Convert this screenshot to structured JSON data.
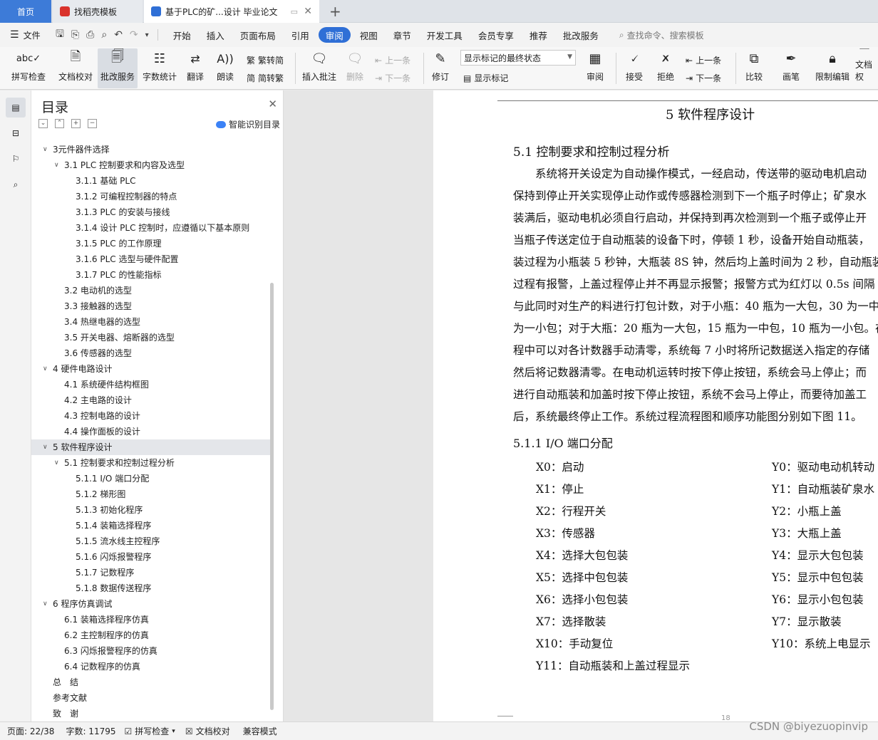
{
  "tabs": [
    {
      "label": "首页"
    },
    {
      "label": "找稻壳模板"
    },
    {
      "label": "基于PLC的矿...设计 毕业论文"
    }
  ],
  "menu": {
    "file": "文件",
    "items": [
      "开始",
      "插入",
      "页面布局",
      "引用",
      "审阅",
      "视图",
      "章节",
      "开发工具",
      "会员专享",
      "推荐",
      "批改服务"
    ],
    "active": "审阅",
    "search_placeholder": "查找命令、搜索模板"
  },
  "ribbon": {
    "spellcheck": "拼写检查",
    "doccheck": "文档校对",
    "review_service": "批改服务",
    "wordcount": "字数统计",
    "translate": "翻译",
    "read_aloud": "朗读",
    "trad": "繁转简",
    "simp": "简转繁",
    "insert_comment": "插入批注",
    "delete": "删除",
    "prev": "上一条",
    "next": "下一条",
    "revise": "修订",
    "markup_state": "显示标记的最终状态",
    "show_markup": "显示标记",
    "review": "审阅",
    "accept": "接受",
    "reject": "拒绝",
    "prev2": "上一条",
    "next2": "下一条",
    "compare": "比较",
    "pen": "画笔",
    "restrict": "限制编辑",
    "doc_right": "文档权"
  },
  "toc": {
    "title": "目录",
    "smart": "智能识别目录",
    "items": [
      {
        "level": 1,
        "label": "3元件器件选择",
        "caret": true
      },
      {
        "level": 2,
        "label": "3.1 PLC 控制要求和内容及选型",
        "caret": true
      },
      {
        "level": 3,
        "label": "3.1.1 基础 PLC"
      },
      {
        "level": 3,
        "label": "3.1.2 可编程控制器的特点"
      },
      {
        "level": 3,
        "label": "3.1.3 PLC 的安装与接线"
      },
      {
        "level": 3,
        "label": "3.1.4 设计 PLC 控制时，应遵循以下基本原则"
      },
      {
        "level": 3,
        "label": "3.1.5 PLC 的工作原理"
      },
      {
        "level": 3,
        "label": "3.1.6 PLC 选型与硬件配置"
      },
      {
        "level": 3,
        "label": "3.1.7 PLC 的性能指标"
      },
      {
        "level": 2,
        "label": "3.2 电动机的选型"
      },
      {
        "level": 2,
        "label": "3.3 接触器的选型"
      },
      {
        "level": 2,
        "label": "3.4 热继电器的选型"
      },
      {
        "level": 2,
        "label": "3.5 开关电器、熔断器的选型"
      },
      {
        "level": 2,
        "label": "3.6 传感器的选型"
      },
      {
        "level": 1,
        "label": "4 硬件电路设计",
        "caret": true
      },
      {
        "level": 2,
        "label": "4.1 系统硬件结构框图"
      },
      {
        "level": 2,
        "label": "4.2 主电路的设计"
      },
      {
        "level": 2,
        "label": "4.3 控制电路的设计"
      },
      {
        "level": 2,
        "label": "4.4 操作面板的设计"
      },
      {
        "level": 1,
        "label": "5 软件程序设计",
        "caret": true,
        "selected": true
      },
      {
        "level": 2,
        "label": "5.1 控制要求和控制过程分析",
        "caret": true
      },
      {
        "level": 3,
        "label": "5.1.1 I/O 端口分配"
      },
      {
        "level": 3,
        "label": "5.1.2 梯形图"
      },
      {
        "level": 3,
        "label": "5.1.3 初始化程序"
      },
      {
        "level": 3,
        "label": "5.1.4 装箱选择程序"
      },
      {
        "level": 3,
        "label": "5.1.5 流水线主控程序"
      },
      {
        "level": 3,
        "label": "5.1.6 闪烁报警程序"
      },
      {
        "level": 3,
        "label": "5.1.7 记数程序"
      },
      {
        "level": 3,
        "label": "5.1.8 数据传送程序"
      },
      {
        "level": 1,
        "label": "6 程序仿真调试",
        "caret": true
      },
      {
        "level": 2,
        "label": "6.1 装箱选择程序仿真"
      },
      {
        "level": 2,
        "label": "6.2 主控制程序的仿真"
      },
      {
        "level": 2,
        "label": "6.3 闪烁报警程序的仿真"
      },
      {
        "level": 2,
        "label": "6.4 记数程序的仿真"
      },
      {
        "level": 1,
        "label": "总　结"
      },
      {
        "level": 1,
        "label": "参考文献"
      },
      {
        "level": 1,
        "label": "致　谢"
      }
    ]
  },
  "doc": {
    "chapter": "5  软件程序设计",
    "section": "5.1 控制要求和控制过程分析",
    "paragraph": [
      "　　系统将开关设定为自动操作模式，一经启动，传送带的驱动电机启动",
      "保持到停止开关实现停止动作或传感器检测到下一个瓶子时停止；矿泉水",
      "装满后，驱动电机必须自行启动，并保持到再次检测到一个瓶子或停止开",
      "当瓶子传送定位于自动瓶装的设备下时，停顿 1 秒，设备开始自动瓶装，",
      "装过程为小瓶装 5 秒钟，大瓶装 8S 钟，然后均上盖时间为 2 秒，自动瓶装",
      "过程有报警，上盖过程停止并不再显示报警；报警方式为红灯以 0.5s 间隔",
      "与此同时对生产的料进行打包计数，对于小瓶：40 瓶为一大包，30 为一中",
      "为一小包；对于大瓶：20 瓶为一大包，15 瓶为一中包，10 瓶为一小包。在",
      "程中可以对各计数器手动清零，系统每 7 小时将所记数据送入指定的存储",
      "然后将记数器清零。在电动机运转时按下停止按钮，系统会马上停止；而",
      "进行自动瓶装和加盖时按下停止按钮，系统不会马上停止，而要待加盖工",
      "后，系统最终停止工作。系统过程流程图和顺序功能图分别如下图 11。"
    ],
    "subsection": "5.1.1 I/O 端口分配",
    "io_left": [
      "X0：启动",
      "X1：停止",
      "X2：行程开关",
      "X3：传感器",
      "X4：选择大包包装",
      "X5：选择中包包装",
      "X6：选择小包包装",
      "X7：选择散装",
      "X10：手动复位",
      "Y11：自动瓶装和上盖过程显示"
    ],
    "io_right": [
      "Y0：驱动电动机转动",
      "Y1：自动瓶装矿泉水",
      "Y2：小瓶上盖",
      "Y3：大瓶上盖",
      "Y4：显示大包包装",
      "Y5：显示中包包装",
      "Y6：显示小包包装",
      "Y7：显示散装",
      "Y10：系统上电显示"
    ],
    "page_number": "18"
  },
  "status": {
    "page": "页面: 22/38",
    "words": "字数: 11795",
    "spell": "拼写检查",
    "doccheck": "文档校对",
    "compat": "兼容模式"
  },
  "watermark": "CSDN @biyezuopinvip",
  "colors": {
    "accent": "#2f6fd6",
    "home_tab": "#3d7bd8",
    "wps_red": "#d9322b"
  }
}
